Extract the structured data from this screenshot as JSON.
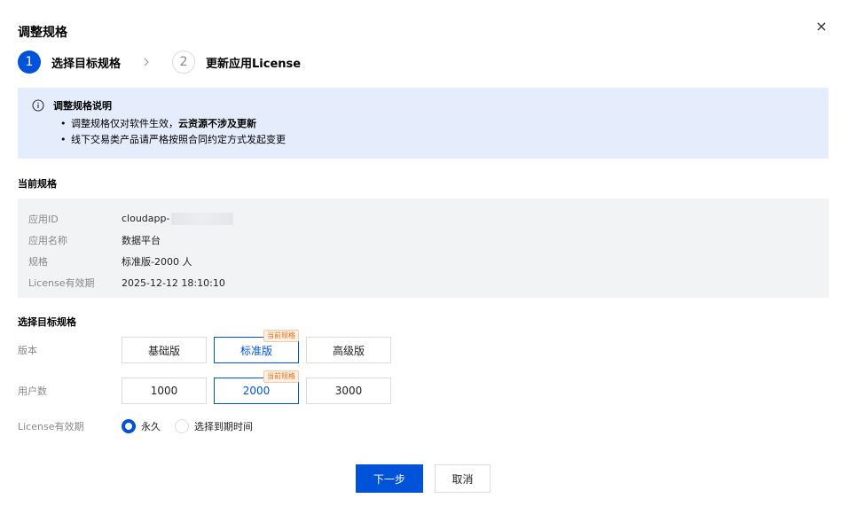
{
  "dialog": {
    "title": "调整规格"
  },
  "steps": [
    {
      "num": "1",
      "label": "选择目标规格"
    },
    {
      "num": "2",
      "label": "更新应用License"
    }
  ],
  "notice": {
    "title": "调整规格说明",
    "item1_prefix": "调整规格仅对软件生效，",
    "item1_bold": "云资源不涉及更新",
    "item2": "线下交易类产品请严格按照合同约定方式发起变更"
  },
  "current": {
    "section_title": "当前规格",
    "rows": [
      {
        "key": "应用ID",
        "value": "cloudapp-"
      },
      {
        "key": "应用名称",
        "value": "数据平台"
      },
      {
        "key": "规格",
        "value": "标准版-2000 人"
      },
      {
        "key": "License有效期",
        "value": "2025-12-12 18:10:10"
      }
    ]
  },
  "target": {
    "section_title": "选择目标规格",
    "edition": {
      "label": "版本",
      "options": [
        "基础版",
        "标准版",
        "高级版"
      ],
      "selected": 1,
      "badge": "当前规格"
    },
    "users": {
      "label": "用户数",
      "options": [
        "1000",
        "2000",
        "3000"
      ],
      "selected": 1,
      "badge": "当前规格"
    },
    "license": {
      "label": "License有效期",
      "options": [
        "永久",
        "选择到期时间"
      ],
      "selected": 0
    }
  },
  "footer": {
    "next_label": "下一步",
    "cancel_label": "取消"
  },
  "colors": {
    "primary": "#0052d9",
    "notice_bg": "#e5edfd",
    "card_bg": "#f2f3f5",
    "badge": "#e37318"
  },
  "icons": {
    "close": "close-icon",
    "info": "info-icon",
    "arrow": "chevron-right-icon"
  }
}
